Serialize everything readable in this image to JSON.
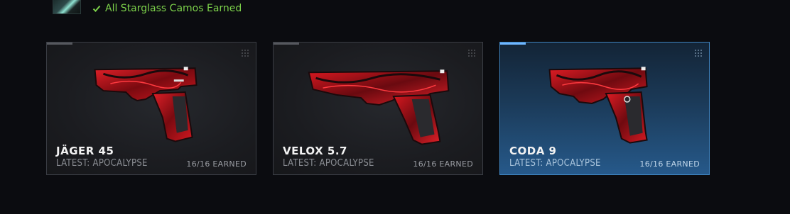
{
  "header": {
    "status_text": "All Starglass Camos Earned",
    "status_color": "#7cd14a",
    "thumbnail_icon": "starglass-camo-thumbnail"
  },
  "cards": [
    {
      "name": "JÄGER 45",
      "latest": "LATEST: APOCALYPSE",
      "earned": "16/16 EARNED",
      "selected": false
    },
    {
      "name": "VELOX 5.7",
      "latest": "LATEST: APOCALYPSE",
      "earned": "16/16 EARNED",
      "selected": false
    },
    {
      "name": "CODA 9",
      "latest": "LATEST: APOCALYPSE",
      "earned": "16/16 EARNED",
      "selected": true
    }
  ],
  "colors": {
    "camo_red": "#c0141c",
    "camo_dark": "#1a0a0c",
    "selected_border": "#3f84c0"
  }
}
